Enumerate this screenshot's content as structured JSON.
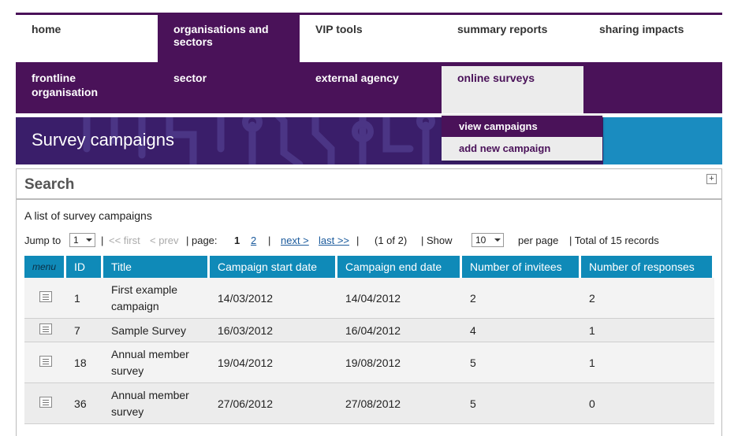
{
  "topnav": {
    "items": [
      "home",
      "organisations and sectors",
      "VIP tools",
      "summary reports",
      "sharing impacts"
    ]
  },
  "subnav": {
    "items": [
      "frontline organisation",
      "sector",
      "external agency",
      "online surveys"
    ]
  },
  "dropdown": {
    "items": [
      "view campaigns",
      "add new campaign"
    ]
  },
  "page_title": "Survey campaigns",
  "search": {
    "label": "Search",
    "toggle": "+"
  },
  "caption": "A list of survey campaigns",
  "pager": {
    "jump_to": "Jump to",
    "jump_value": "1",
    "first": "<< first",
    "prev": "< prev",
    "page_label": "| page:",
    "page_current": "1",
    "page_other": "2",
    "next": "next >",
    "last": "last >>",
    "page_of": "(1 of 2)",
    "show_label": "| Show",
    "show_value": "10",
    "per_page": "per page",
    "total": "| Total of 15  records",
    "sep": "|"
  },
  "table": {
    "headers": [
      "menu",
      "ID",
      "Title",
      "Campaign start date",
      "Campaign end date",
      "Number of invitees",
      "Number of responses"
    ],
    "rows": [
      {
        "id": "1",
        "title": "First example campaign",
        "start": "14/03/2012",
        "end": "14/04/2012",
        "invitees": "2",
        "responses": "2"
      },
      {
        "id": "7",
        "title": "Sample Survey",
        "start": "16/03/2012",
        "end": "16/04/2012",
        "invitees": "4",
        "responses": "1"
      },
      {
        "id": "18",
        "title": "Annual member survey",
        "start": "19/04/2012",
        "end": "19/08/2012",
        "invitees": "5",
        "responses": "1"
      },
      {
        "id": "36",
        "title": "Annual member survey",
        "start": "27/06/2012",
        "end": "27/08/2012",
        "invitees": "5",
        "responses": "0"
      }
    ]
  },
  "colors": {
    "purple": "#4a1259",
    "blue": "#0f8ab8"
  }
}
